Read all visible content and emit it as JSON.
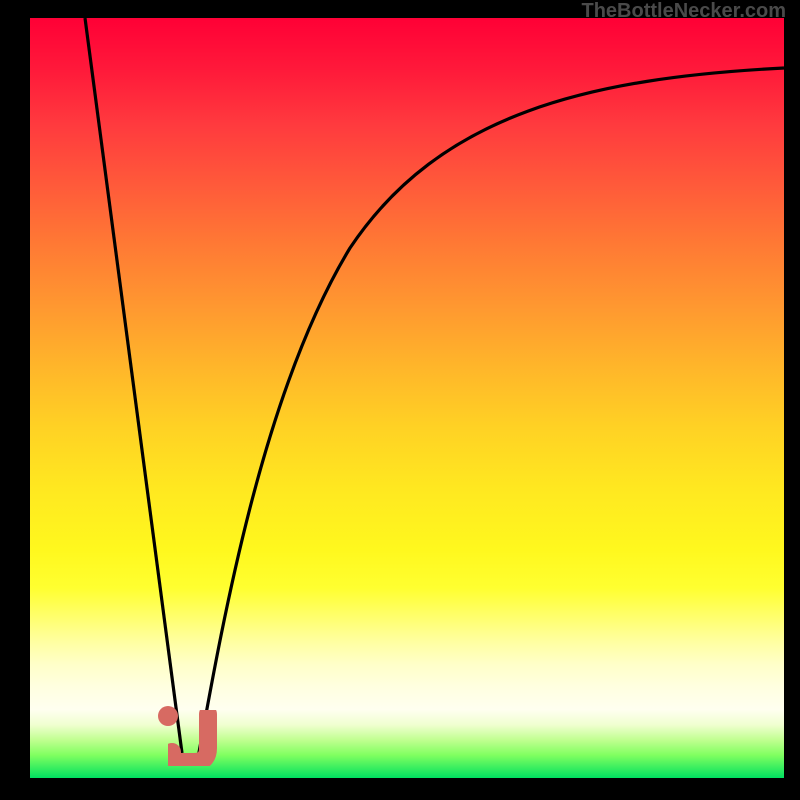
{
  "attribution": "TheBottleNecker.com",
  "chart_data": {
    "type": "line",
    "title": "",
    "xlabel": "",
    "ylabel": "",
    "xlim": [
      0,
      100
    ],
    "ylim": [
      0,
      100
    ],
    "series": [
      {
        "name": "left-branch",
        "x": [
          7,
          20
        ],
        "y": [
          100,
          3
        ]
      },
      {
        "name": "right-branch",
        "x": [
          22,
          26,
          30,
          35,
          42,
          55,
          75,
          100
        ],
        "y": [
          3,
          30,
          52,
          68,
          80,
          88,
          92,
          94
        ]
      }
    ],
    "markers": [
      {
        "name": "dot",
        "x": 19,
        "y": 9,
        "color": "#d76a62",
        "shape": "circle"
      },
      {
        "name": "hook",
        "x": 23,
        "y": 5,
        "color": "#d76a62",
        "shape": "j-hook"
      }
    ],
    "background_gradient": {
      "orientation": "vertical",
      "stops": [
        {
          "pos": 0.0,
          "color": "#ff0036"
        },
        {
          "pos": 0.5,
          "color": "#ffcc20"
        },
        {
          "pos": 0.75,
          "color": "#ffff30"
        },
        {
          "pos": 0.92,
          "color": "#ffffff"
        },
        {
          "pos": 1.0,
          "color": "#00e060"
        }
      ]
    }
  }
}
